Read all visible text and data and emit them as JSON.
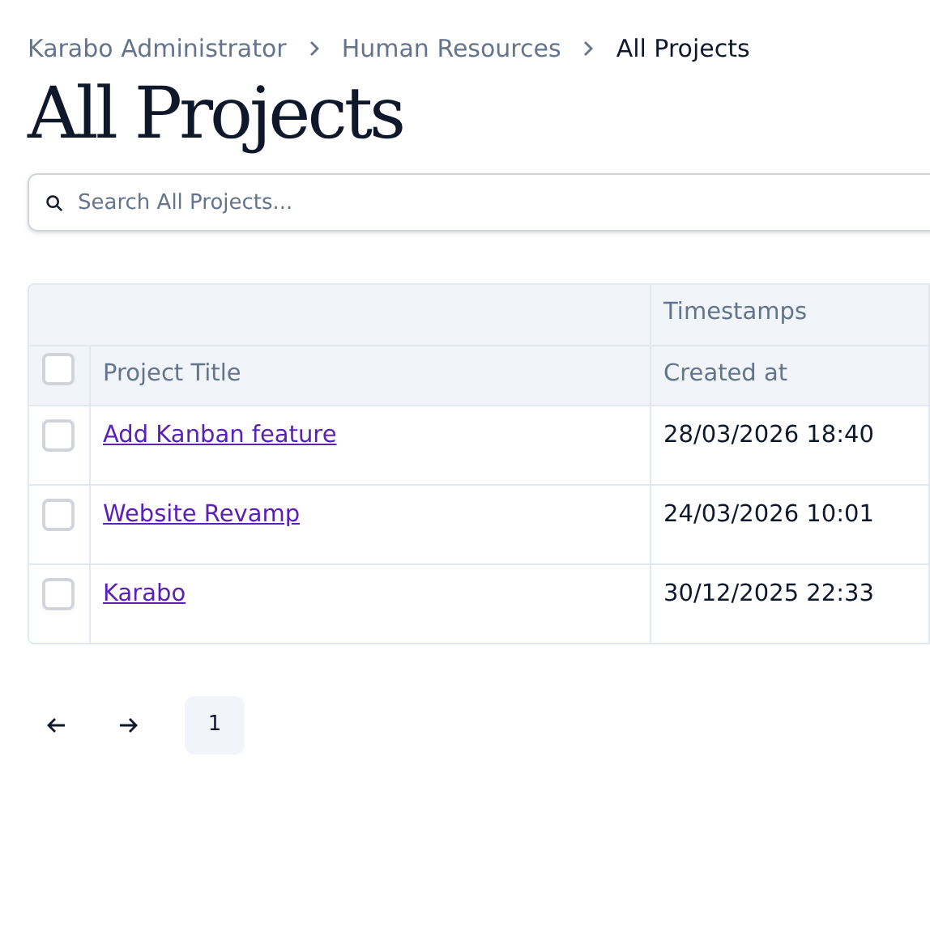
{
  "breadcrumbs": [
    {
      "label": "Karabo Administrator",
      "current": false
    },
    {
      "label": "Human Resources",
      "current": false
    },
    {
      "label": "All Projects",
      "current": true
    }
  ],
  "title": "All Projects",
  "search": {
    "placeholder": "Search All Projects..."
  },
  "table": {
    "group_header": "Timestamps",
    "select_all": {
      "checked": false
    },
    "columns": [
      "Project Title",
      "Created at"
    ],
    "rows": [
      {
        "checked": false,
        "title": "Add Kanban feature",
        "created_at": "28/03/2026 18:40"
      },
      {
        "checked": false,
        "title": "Website Revamp",
        "created_at": "24/03/2026 10:01"
      },
      {
        "checked": false,
        "title": "Karabo",
        "created_at": "30/12/2025 22:33"
      }
    ]
  },
  "pagination": {
    "pages": [
      {
        "label": "1",
        "selected": true
      }
    ]
  }
}
